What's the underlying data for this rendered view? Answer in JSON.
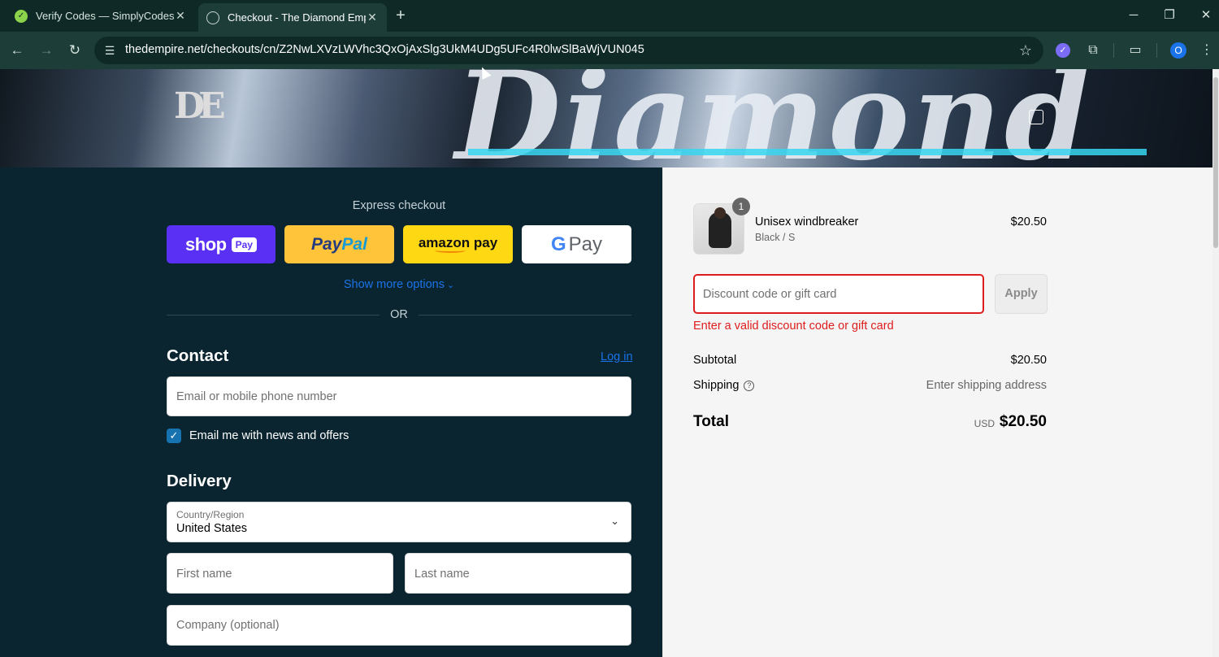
{
  "browser": {
    "tabs": [
      {
        "title": "Verify Codes — SimplyCodes",
        "active": false,
        "favicon": "simplycodes-icon"
      },
      {
        "title": "Checkout - The Diamond Empir",
        "active": true,
        "favicon": "globe-icon"
      }
    ],
    "url_domain": "thedempire.net",
    "url_path": "/checkouts/cn/Z2NwLXVzLWVhc3QxOjAxSlg3UkM4UDg5UFc4R0lwSlBaWjVUN045",
    "profile_initial": "O"
  },
  "banner": {
    "logo_text": "DE"
  },
  "express": {
    "label": "Express checkout",
    "shop_pay": {
      "text": "shop",
      "badge": "Pay"
    },
    "paypal": {
      "part1": "Pay",
      "part2": "Pal"
    },
    "amazon_pay": "amazon pay",
    "google_pay": {
      "g": "G",
      "text": "Pay"
    },
    "more_options": "Show more options",
    "or": "OR"
  },
  "contact": {
    "heading": "Contact",
    "login": "Log in",
    "email_placeholder": "Email or mobile phone number",
    "newsletter_label": "Email me with news and offers",
    "newsletter_checked": true
  },
  "delivery": {
    "heading": "Delivery",
    "country_label": "Country/Region",
    "country_value": "United States",
    "first_name_placeholder": "First name",
    "last_name_placeholder": "Last name",
    "company_placeholder": "Company (optional)"
  },
  "summary": {
    "item": {
      "name": "Unisex windbreaker",
      "variant": "Black / S",
      "price": "$20.50",
      "quantity": "1"
    },
    "discount_placeholder": "Discount code or gift card",
    "apply_label": "Apply",
    "discount_error": "Enter a valid discount code or gift card",
    "subtotal_label": "Subtotal",
    "subtotal_value": "$20.50",
    "shipping_label": "Shipping",
    "shipping_value": "Enter shipping address",
    "total_label": "Total",
    "total_currency": "USD",
    "total_value": "$20.50"
  },
  "colors": {
    "left_bg": "#0a2530",
    "right_bg": "#f5f5f5",
    "error": "#dd1d1d",
    "link": "#1a73e8",
    "shop_pay": "#5a31f4",
    "paypal": "#ffc439",
    "amazon": "#ffd814"
  }
}
